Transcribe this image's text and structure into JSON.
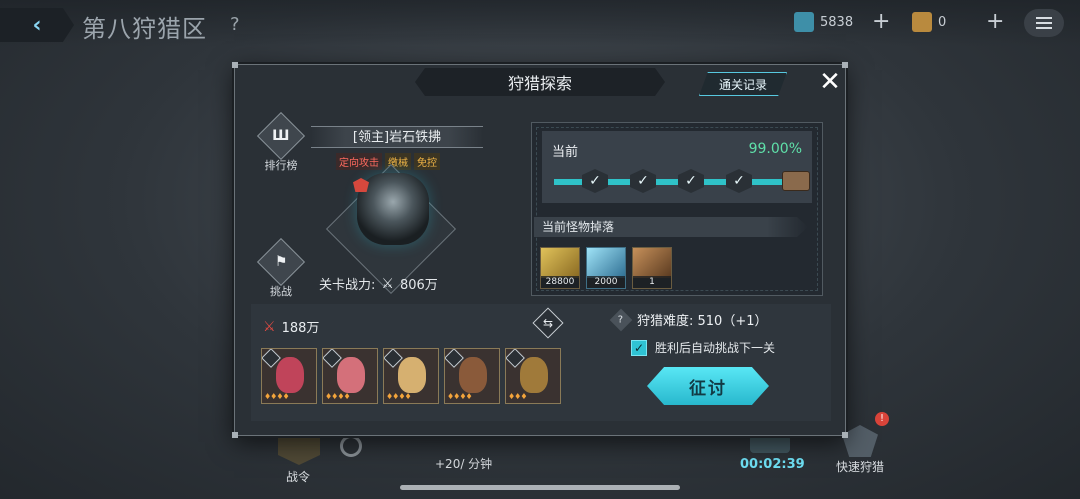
{
  "topbar": {
    "zone_title": "第八狩猎区",
    "help": "?",
    "resource_1_value": "5838",
    "resource_2_value": "0",
    "plus": "+",
    "back_arrow": "‹"
  },
  "bottom": {
    "battle_pass_label": "战令",
    "rate_text": "+20/ 分钟",
    "timer": "00:02:39",
    "quick_hunt_label": "快速狩猎",
    "alert_count": "!"
  },
  "dialog": {
    "title": "狩猎探索",
    "record_button": "通关记录",
    "close": "✕",
    "ranking_label": "排行榜",
    "challenge_label": "挑战",
    "boss_name": "[领主]岩石铁拂",
    "tags": [
      "定向攻击",
      "缴械",
      "免控"
    ],
    "stage_power_label": "关卡战力:",
    "stage_power_value": "806万",
    "progress": {
      "current_label": "当前",
      "current_value": "99.00%",
      "checkpoints_cleared": 4
    },
    "drops_title": "当前怪物掉落",
    "drops": [
      {
        "icon": "gold-bars-icon",
        "count": "28800",
        "color": "#c8a23c"
      },
      {
        "icon": "crystal-icon",
        "count": "2000",
        "color": "#4aa6c9"
      },
      {
        "icon": "drill-bit-icon",
        "count": "1",
        "color": "#9a6a3a"
      }
    ],
    "team_power": "188万",
    "difficulty_text": "狩猎难度:  510（+1）",
    "auto_next_label": "胜利后自动挑战下一关",
    "auto_next_checked": true,
    "attack_button": "征讨",
    "heroes": [
      {
        "name": "hero-1",
        "color": "#c0445a"
      },
      {
        "name": "hero-2",
        "color": "#d4707a"
      },
      {
        "name": "hero-3",
        "color": "#d6b070"
      },
      {
        "name": "hero-4",
        "color": "#8a5a3a"
      },
      {
        "name": "hero-5",
        "color": "#a07a3a"
      }
    ]
  }
}
